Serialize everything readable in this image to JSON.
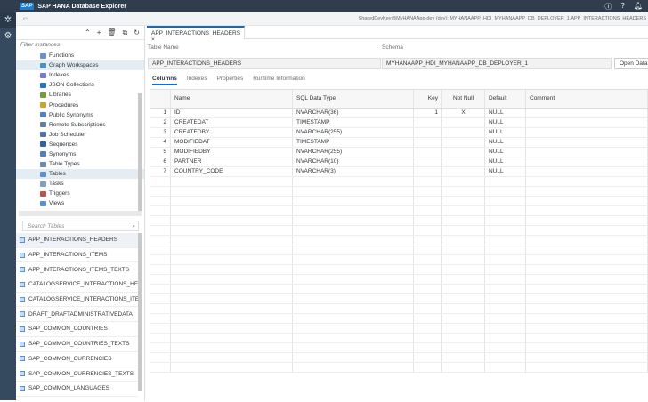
{
  "app": {
    "logo": "SAP",
    "title": "SAP HANA Database Explorer",
    "header_icons": [
      "info-icon",
      "help-icon",
      "bell-icon"
    ]
  },
  "breadcrumb": "SharedDevKey@MyHANAApp-dev (dev): MYHANAAPP_HDI_MYHANAAPP_DB_DEPLOYER_1.APP_INTERACTIONS_HEADERS",
  "left": {
    "toolbar_icons": [
      "collapse-icon",
      "add-icon",
      "delete-icon",
      "add-folder-icon",
      "refresh-icon"
    ],
    "filter_placeholder": "Filter Instances",
    "tree": [
      {
        "label": "Functions",
        "color": "#6b8fd6"
      },
      {
        "label": "Graph Workspaces",
        "color": "#4a90c0",
        "selected": true
      },
      {
        "label": "Indexes",
        "color": "#7a7ad0"
      },
      {
        "label": "JSON Collections",
        "color": "#2a6fc0"
      },
      {
        "label": "Libraries",
        "color": "#7a9a3a"
      },
      {
        "label": "Procedures",
        "color": "#d0a030"
      },
      {
        "label": "Public Synonyms",
        "color": "#5080c0"
      },
      {
        "label": "Remote Subscriptions",
        "color": "#6080a0"
      },
      {
        "label": "Job Scheduler",
        "color": "#5070b0"
      },
      {
        "label": "Sequences",
        "color": "#3060b0"
      },
      {
        "label": "Synonyms",
        "color": "#5080c0"
      },
      {
        "label": "Table Types",
        "color": "#6a8ab0"
      },
      {
        "label": "Tables",
        "color": "#5c8ed0",
        "selected": true
      },
      {
        "label": "Tasks",
        "color": "#80a0c0"
      },
      {
        "label": "Triggers",
        "color": "#c05050"
      },
      {
        "label": "Views",
        "color": "#5c8ed0"
      }
    ],
    "search_placeholder": "Search Tables",
    "tables": [
      "APP_INTERACTIONS_HEADERS",
      "APP_INTERACTIONS_ITEMS",
      "APP_INTERACTIONS_ITEMS_TEXTS",
      "CATALOGSERVICE_INTERACTIONS_HEADERS",
      "CATALOGSERVICE_INTERACTIONS_ITEMS",
      "DRAFT_DRAFTADMINISTRATIVEDATA",
      "SAP_COMMON_COUNTRIES",
      "SAP_COMMON_COUNTRIES_TEXTS",
      "SAP_COMMON_CURRENCIES",
      "SAP_COMMON_CURRENCIES_TEXTS",
      "SAP_COMMON_LANGUAGES"
    ]
  },
  "main": {
    "tab": "APP_INTERACTIONS_HEADERS",
    "table_name_label": "Table Name",
    "table_name": "APP_INTERACTIONS_HEADERS",
    "schema_label": "Schema",
    "schema": "MYHANAAPP_HDI_MYHANAAPP_DB_DEPLOYER_1",
    "open_data": "Open Data",
    "tabs": [
      "Columns",
      "Indexes",
      "Properties",
      "Runtime Information"
    ],
    "columns": [
      "",
      "Name",
      "SQL Data Type",
      "Key",
      "Not Null",
      "Default",
      "Comment"
    ],
    "rows": [
      [
        "1",
        "ID",
        "NVARCHAR(36)",
        "1",
        "X",
        "NULL",
        ""
      ],
      [
        "2",
        "CREATEDAT",
        "TIMESTAMP",
        "",
        "",
        "NULL",
        ""
      ],
      [
        "3",
        "CREATEDBY",
        "NVARCHAR(255)",
        "",
        "",
        "NULL",
        ""
      ],
      [
        "4",
        "MODIFIEDAT",
        "TIMESTAMP",
        "",
        "",
        "NULL",
        ""
      ],
      [
        "5",
        "MODIFIEDBY",
        "NVARCHAR(255)",
        "",
        "",
        "NULL",
        ""
      ],
      [
        "6",
        "PARTNER",
        "NVARCHAR(10)",
        "",
        "",
        "NULL",
        ""
      ],
      [
        "7",
        "COUNTRY_CODE",
        "NVARCHAR(3)",
        "",
        "",
        "NULL",
        ""
      ]
    ]
  }
}
